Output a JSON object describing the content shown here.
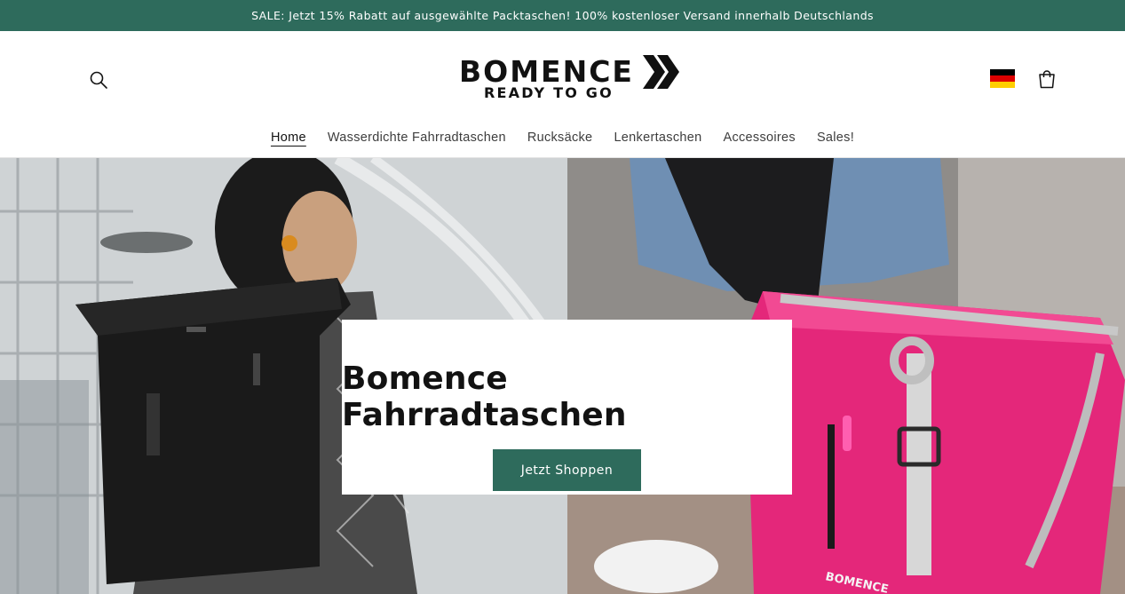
{
  "announcement": {
    "text": "SALE: Jetzt 15% Rabatt auf ausgewählte Packtaschen! 100% kostenloser Versand innerhalb Deutschlands"
  },
  "header": {
    "logo": {
      "brand": "BOMENCE",
      "tagline": "READY TO GO"
    },
    "search_icon": "search-icon",
    "cart_icon": "cart-icon",
    "flag": {
      "name": "germany-flag",
      "colors": [
        "#000000",
        "#dd0000",
        "#ffce00"
      ]
    }
  },
  "nav": {
    "items": [
      {
        "label": "Home",
        "active": true
      },
      {
        "label": "Wasserdichte Fahrradtaschen"
      },
      {
        "label": "Rucksäcke"
      },
      {
        "label": "Lenkertaschen"
      },
      {
        "label": "Accessoires"
      },
      {
        "label": "Sales!"
      }
    ]
  },
  "hero": {
    "title": "Bomence Fahrradtaschen",
    "button_label": "Jetzt Shoppen",
    "bag_brand": "BOMENCE"
  },
  "colors": {
    "accent": "#2e6b5c",
    "pink_bag": "#e4277a"
  }
}
